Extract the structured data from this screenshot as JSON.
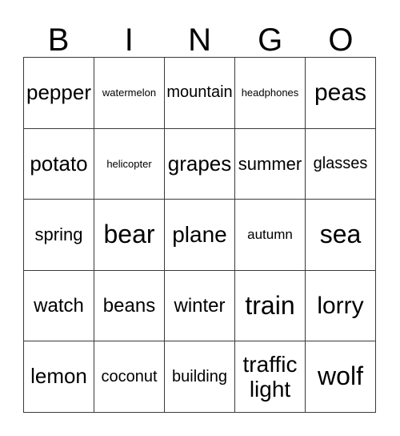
{
  "card": {
    "title": "BINGO",
    "header_letters": [
      "B",
      "I",
      "N",
      "G",
      "O"
    ],
    "columns": 5,
    "rows": 5,
    "border_color": "#3a3a3a",
    "background_color": "#ffffff",
    "text_color": "#000000",
    "cells": [
      [
        {
          "label": "pepper",
          "size": "fs-xl"
        },
        {
          "label": "watermelon",
          "size": "fs-xs"
        },
        {
          "label": "mountain",
          "size": "fs-m"
        },
        {
          "label": "headphones",
          "size": "fs-xs"
        },
        {
          "label": "peas",
          "size": "fs-h"
        }
      ],
      [
        {
          "label": "potato",
          "size": "fs-xl"
        },
        {
          "label": "helicopter",
          "size": "fs-xs"
        },
        {
          "label": "grapes",
          "size": "fs-xl"
        },
        {
          "label": "summer",
          "size": "fs-ml"
        },
        {
          "label": "glasses",
          "size": "fs-m"
        }
      ],
      [
        {
          "label": "spring",
          "size": "fs-ml"
        },
        {
          "label": "bear",
          "size": "fs-hh"
        },
        {
          "label": "plane",
          "size": "fs-xxl"
        },
        {
          "label": "autumn",
          "size": "fs-s"
        },
        {
          "label": "sea",
          "size": "fs-hh"
        }
      ],
      [
        {
          "label": "watch",
          "size": "fs-l"
        },
        {
          "label": "beans",
          "size": "fs-l"
        },
        {
          "label": "winter",
          "size": "fs-l"
        },
        {
          "label": "train",
          "size": "fs-hh"
        },
        {
          "label": "lorry",
          "size": "fs-h"
        }
      ],
      [
        {
          "label": "lemon",
          "size": "fs-xl"
        },
        {
          "label": "coconut",
          "size": "fs-m"
        },
        {
          "label": "building",
          "size": "fs-m"
        },
        {
          "label": "traffic\nlight",
          "size": "fs-two"
        },
        {
          "label": "wolf",
          "size": "fs-hh"
        }
      ]
    ]
  }
}
